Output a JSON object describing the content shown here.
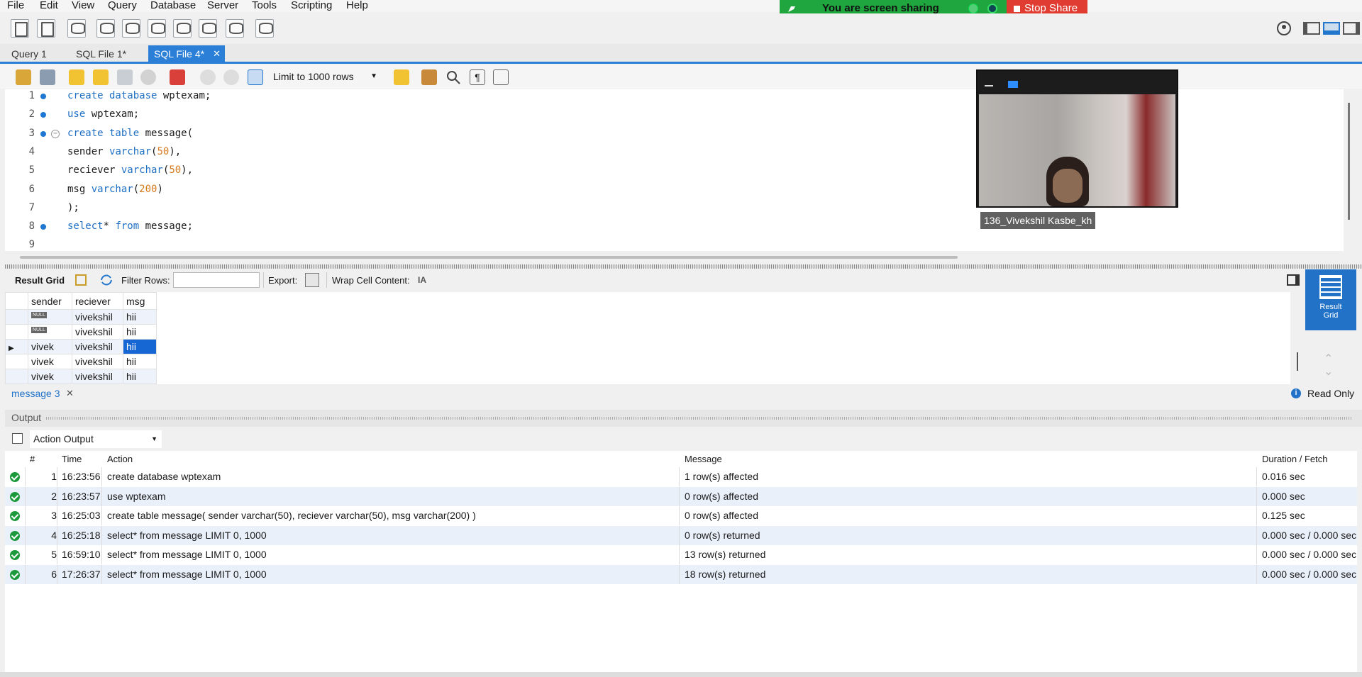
{
  "menu": [
    "File",
    "Edit",
    "View",
    "Query",
    "Database",
    "Server",
    "Tools",
    "Scripting",
    "Help"
  ],
  "share_banner": {
    "status": "You are screen sharing",
    "stop_label": "Stop Share"
  },
  "tabs": [
    {
      "label": "Query 1"
    },
    {
      "label": "SQL File 1*"
    },
    {
      "label": "SQL File 4*",
      "active": true
    }
  ],
  "editor_toolbar": {
    "limit_label": "Limit to 1000 rows"
  },
  "editor": {
    "line_numbers": [
      "1",
      "2",
      "3",
      "4",
      "5",
      "6",
      "7",
      "8",
      "9"
    ],
    "lines": [
      [
        {
          "t": "create database",
          "c": "kw"
        },
        {
          "t": " wptexam;",
          "c": ""
        }
      ],
      [
        {
          "t": "use",
          "c": "kw"
        },
        {
          "t": " wptexam;",
          "c": ""
        }
      ],
      [
        {
          "t": "create table",
          "c": "kw"
        },
        {
          "t": " message(",
          "c": ""
        }
      ],
      [
        {
          "t": "sender ",
          "c": ""
        },
        {
          "t": "varchar",
          "c": "kw"
        },
        {
          "t": "(",
          "c": ""
        },
        {
          "t": "50",
          "c": "num"
        },
        {
          "t": "),",
          "c": ""
        }
      ],
      [
        {
          "t": "reciever ",
          "c": ""
        },
        {
          "t": "varchar",
          "c": "kw"
        },
        {
          "t": "(",
          "c": ""
        },
        {
          "t": "50",
          "c": "num"
        },
        {
          "t": "),",
          "c": ""
        }
      ],
      [
        {
          "t": "msg ",
          "c": ""
        },
        {
          "t": "varchar",
          "c": "kw"
        },
        {
          "t": "(",
          "c": ""
        },
        {
          "t": "200",
          "c": "num"
        },
        {
          "t": ")",
          "c": ""
        }
      ],
      [
        {
          "t": ");",
          "c": ""
        }
      ],
      [
        {
          "t": "select",
          "c": "kw"
        },
        {
          "t": "* ",
          "c": ""
        },
        {
          "t": "from",
          "c": "kw"
        },
        {
          "t": " message;",
          "c": ""
        }
      ]
    ]
  },
  "video": {
    "participant": "136_Vivekshil Kasbe_kh"
  },
  "result_toolbar": {
    "result_grid": "Result Grid",
    "filter_rows": "Filter Rows:",
    "export": "Export:",
    "wrap": "Wrap Cell Content:"
  },
  "result_side": {
    "line1": "Result",
    "line2": "Grid"
  },
  "grid": {
    "columns": [
      "sender",
      "reciever",
      "msg"
    ],
    "rows": [
      [
        "NULL",
        "vivekshil",
        "hii"
      ],
      [
        "NULL",
        "vivekshil",
        "hii"
      ],
      [
        "vivek",
        "vivekshil",
        "hii"
      ],
      [
        "vivek",
        "vivekshil",
        "hii"
      ],
      [
        "vivek",
        "vivekshil",
        "hii"
      ]
    ],
    "selected_row": 2
  },
  "result_tab": {
    "label": "message 3",
    "read_only": "Read Only"
  },
  "output": {
    "header": "Output",
    "select_value": "Action Output",
    "columns": [
      "#",
      "Time",
      "Action",
      "Message",
      "Duration / Fetch"
    ],
    "rows": [
      [
        "1",
        "16:23:56",
        "create database wptexam",
        "1 row(s) affected",
        "0.016 sec"
      ],
      [
        "2",
        "16:23:57",
        "use wptexam",
        "0 row(s) affected",
        "0.000 sec"
      ],
      [
        "3",
        "16:25:03",
        "create table message( sender varchar(50), reciever varchar(50), msg varchar(200) )",
        "0 row(s) affected",
        "0.125 sec"
      ],
      [
        "4",
        "16:25:18",
        "select* from message LIMIT 0, 1000",
        "0 row(s) returned",
        "0.000 sec / 0.000 sec"
      ],
      [
        "5",
        "16:59:10",
        "select* from message LIMIT 0, 1000",
        "13 row(s) returned",
        "0.000 sec / 0.000 sec"
      ],
      [
        "6",
        "17:26:37",
        "select* from message LIMIT 0, 1000",
        "18 row(s) returned",
        "0.000 sec / 0.000 sec"
      ]
    ]
  }
}
